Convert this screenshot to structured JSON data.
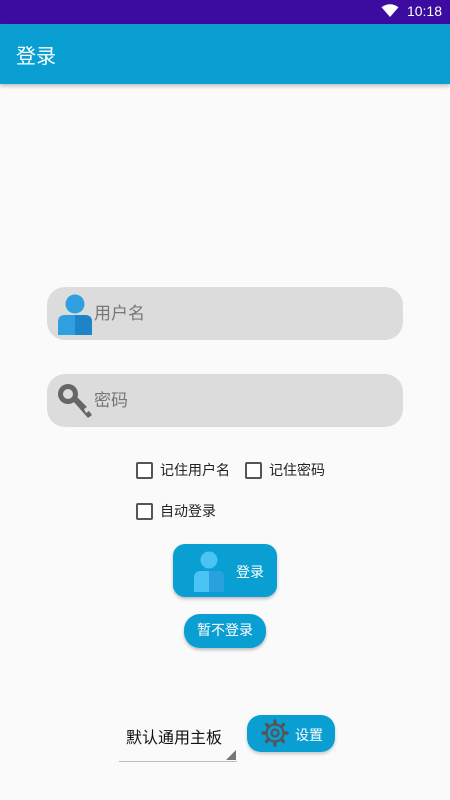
{
  "status_bar": {
    "time": "10:18"
  },
  "app_bar": {
    "title": "登录"
  },
  "login_form": {
    "username_placeholder": "用户名",
    "password_placeholder": "密码",
    "remember_username": "记住用户名",
    "remember_password": "记住密码",
    "auto_login": "自动登录",
    "login_button": "登录",
    "skip_login_button": "暂不登录"
  },
  "footer": {
    "board_select_value": "默认通用主板",
    "settings_button": "设置"
  },
  "colors": {
    "primary": "#0a9fd3",
    "status_bar": "#3c0ca0",
    "field_bg": "#dcdcdc"
  }
}
